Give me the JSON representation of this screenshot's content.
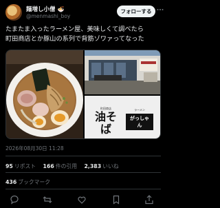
{
  "author": {
    "display_name": "麺増し小僧",
    "emoji": "🍜",
    "handle": "@menmashi_boy",
    "avatar_icon": "avatar-icon"
  },
  "follow_label": "フォローする",
  "more_icon": "more-icon",
  "tweet_lines": [
    "たまたま入ったラーメン屋、美味しくて調べたら",
    "町田商店とか豚山の系列で背筋ゾワァってなった"
  ],
  "media": {
    "sign_left_small": "町田商店",
    "sign_left_big": "油そば",
    "sign_right_small": "ラーメン",
    "sign_right_box": "がっしゃん"
  },
  "timestamp": "2026年08月30日 11:28",
  "stats": {
    "reposts_count": "95",
    "reposts_label": "リポスト",
    "quotes_count": "166",
    "quotes_label": "件の引用",
    "likes_count": "2,383",
    "likes_label": "いいね",
    "bookmarks_count": "436",
    "bookmarks_label": "ブックマーク"
  },
  "actions": [
    "reply-icon",
    "repost-icon",
    "like-icon",
    "bookmark-icon",
    "share-icon"
  ],
  "colors": {
    "background": "#000000",
    "text": "#e7e9ea",
    "muted": "#71767b",
    "border": "#2f3336"
  }
}
